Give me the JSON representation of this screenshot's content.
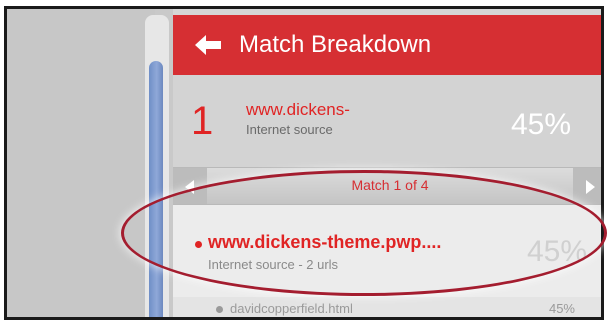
{
  "header": {
    "title": "Match Breakdown",
    "back_icon": "back-arrow-icon"
  },
  "summary": {
    "index": "1",
    "name": "www.dickens-",
    "type": "Internet source",
    "percent": "45%"
  },
  "match_nav": {
    "label": "Match 1 of 4",
    "prev_icon": "chevron-left-icon",
    "next_icon": "chevron-right-icon"
  },
  "source": {
    "name": "www.dickens-theme.pwp....",
    "meta": "Internet source - 2 urls",
    "percent": "45%"
  },
  "subsource": {
    "name": "davidcopperfield.html",
    "percent": "45%"
  },
  "colors": {
    "accent_red": "#d62f33",
    "text_red": "#e02424",
    "scroll_blue": "#7f9bd0",
    "highlight_oval": "#a41d2f"
  }
}
